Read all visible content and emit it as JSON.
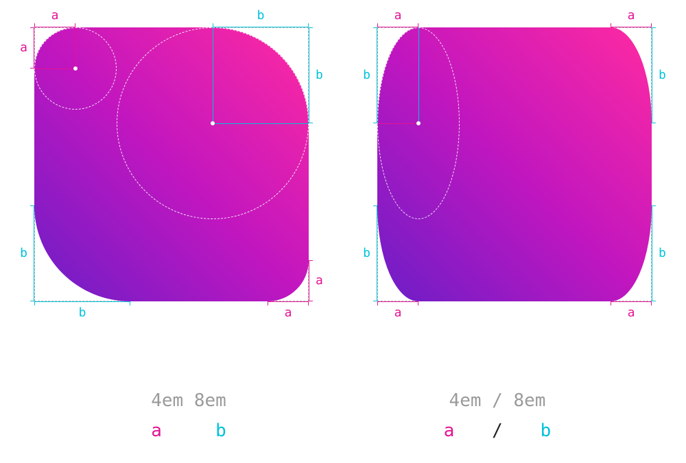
{
  "labels": {
    "a": "a",
    "b": "b"
  },
  "left": {
    "cssValue": "4em 8em",
    "legend": {
      "a": "a",
      "b": "b"
    },
    "corners": {
      "topLeft": {
        "h": "a",
        "v": "a"
      },
      "topRight": {
        "h": "b",
        "v": "b"
      },
      "bottomLeft": {
        "h": "b",
        "v": "b"
      },
      "bottomRight": {
        "h": "a",
        "v": "a"
      }
    }
  },
  "right": {
    "cssValue": "4em / 8em",
    "legend": {
      "a": "a",
      "slash": "/",
      "b": "b"
    },
    "corners": {
      "topLeft": {
        "h": "a",
        "v": "b"
      },
      "topRight": {
        "h": "a",
        "v": "b"
      },
      "bottomLeft": {
        "h": "a",
        "v": "b"
      },
      "bottomRight": {
        "h": "a",
        "v": "b"
      }
    }
  }
}
